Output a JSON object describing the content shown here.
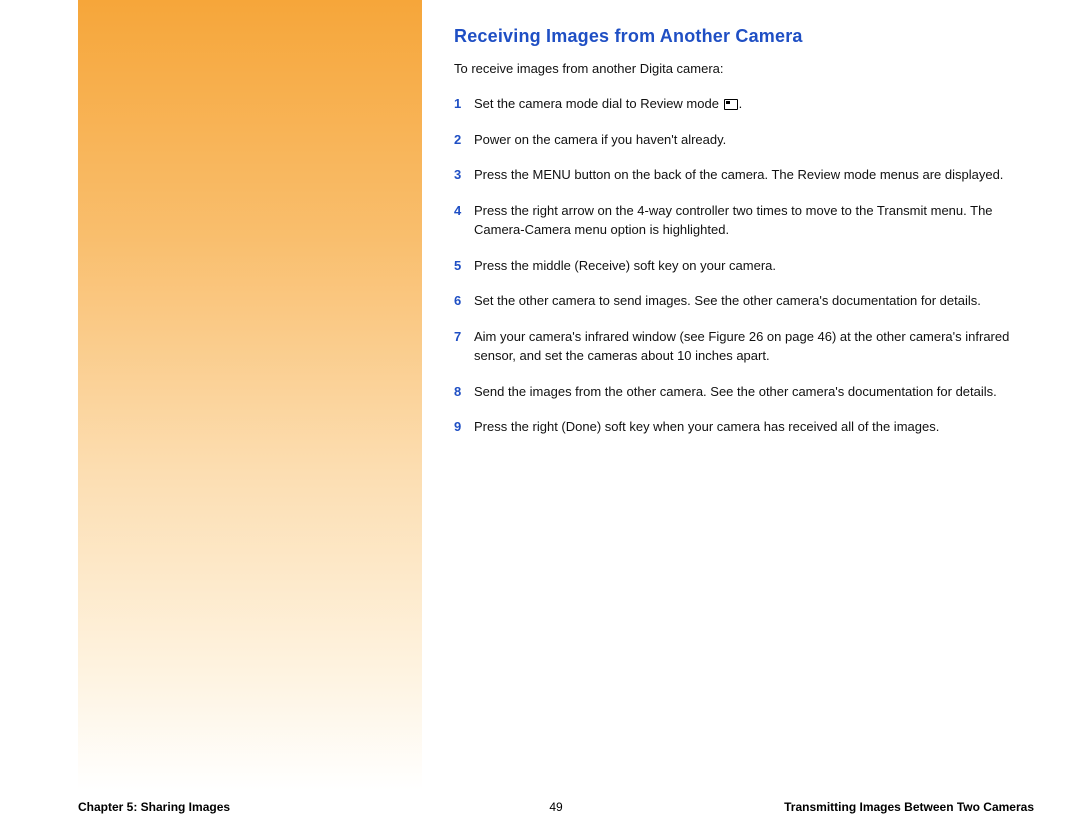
{
  "heading": "Receiving Images from Another Camera",
  "intro": "To receive images from another Digita camera:",
  "steps": [
    {
      "n": "1",
      "pre": "Set the camera mode dial to Review mode ",
      "icon": true,
      "post": "."
    },
    {
      "n": "2",
      "text": "Power on the camera if you haven't already."
    },
    {
      "n": "3",
      "text": "Press the MENU button on the back of the camera. The Review mode menus are displayed."
    },
    {
      "n": "4",
      "text": "Press the right arrow on the 4-way controller two times to move to the Transmit menu. The Camera-Camera menu option is highlighted."
    },
    {
      "n": "5",
      "text": "Press the middle (Receive) soft key on your camera."
    },
    {
      "n": "6",
      "text": "Set the other camera to send images. See the other camera's documentation for details."
    },
    {
      "n": "7",
      "text": "Aim your camera's infrared window (see Figure 26 on page 46) at the other camera's infrared sensor, and set the cameras about 10 inches apart."
    },
    {
      "n": "8",
      "text": "Send the images from the other camera. See the other camera's documentation for details."
    },
    {
      "n": "9",
      "text": "Press the right (Done) soft key when your camera has received all of the images."
    }
  ],
  "footer": {
    "left": "Chapter 5: Sharing Images",
    "center": "49",
    "right": "Transmitting Images Between Two Cameras"
  }
}
